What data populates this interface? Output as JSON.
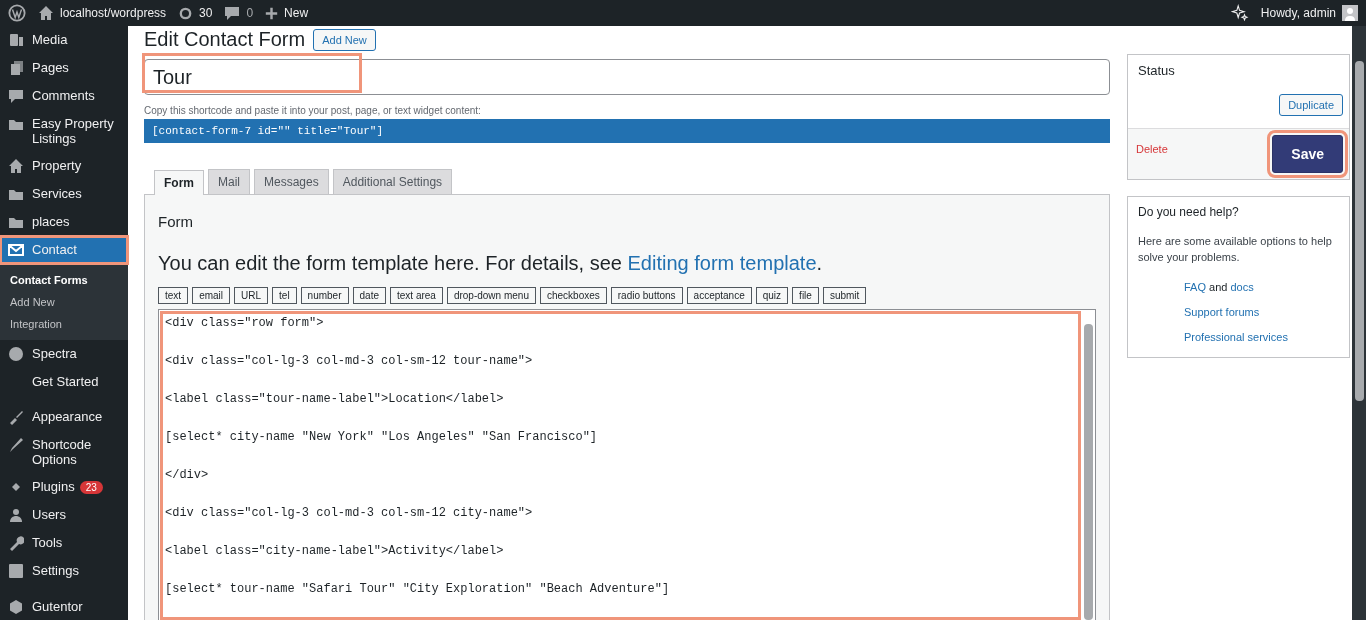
{
  "admin_bar": {
    "site": "localhost/wordpress",
    "updates": "30",
    "comments": "0",
    "new": "New",
    "greeting": "Howdy, admin"
  },
  "sidebar": {
    "items": [
      {
        "label": "Media",
        "selected": false,
        "highlighted": false
      },
      {
        "label": "Pages",
        "selected": false,
        "highlighted": false
      },
      {
        "label": "Comments",
        "selected": false,
        "highlighted": false
      },
      {
        "label": "Easy Property Listings",
        "selected": false,
        "highlighted": false
      },
      {
        "label": "Property",
        "selected": false,
        "highlighted": false
      },
      {
        "label": "Services",
        "selected": false,
        "highlighted": false
      },
      {
        "label": "places",
        "selected": false,
        "highlighted": false
      },
      {
        "label": "Contact",
        "selected": true,
        "highlighted": true,
        "children": [
          {
            "label": "Contact Forms",
            "selected": true
          },
          {
            "label": "Add New",
            "selected": false
          },
          {
            "label": "Integration",
            "selected": false
          }
        ]
      },
      {
        "label": "Spectra",
        "selected": false,
        "highlighted": false
      },
      {
        "label": "Get Started",
        "selected": false,
        "highlighted": false
      },
      {
        "label": "Appearance",
        "selected": false,
        "highlighted": false
      },
      {
        "label": "Shortcode Options",
        "selected": false,
        "highlighted": false
      },
      {
        "label": "Plugins",
        "selected": false,
        "highlighted": false,
        "badge": "23"
      },
      {
        "label": "Users",
        "selected": false,
        "highlighted": false
      },
      {
        "label": "Tools",
        "selected": false,
        "highlighted": false
      },
      {
        "label": "Settings",
        "selected": false,
        "highlighted": false
      },
      {
        "label": "Gutentor",
        "selected": false,
        "highlighted": false
      }
    ]
  },
  "page": {
    "title": "Edit Contact Form",
    "add_new": "Add New"
  },
  "title_field": {
    "value": "Tour",
    "highlighted": true
  },
  "shortcode": {
    "hint": "Copy this shortcode and paste it into your post, page, or text widget content:",
    "code": "[contact-form-7 id=\"\" title=\"Tour\"]"
  },
  "tabs": [
    {
      "label": "Form",
      "selected": true
    },
    {
      "label": "Mail",
      "selected": false
    },
    {
      "label": "Messages",
      "selected": false
    },
    {
      "label": "Additional Settings",
      "selected": false
    }
  ],
  "form_panel": {
    "heading": "Form",
    "intro": "You can edit the form template here. For details, see ",
    "link": "Editing form template",
    "after": ".",
    "tags": [
      "text",
      "email",
      "URL",
      "tel",
      "number",
      "date",
      "text area",
      "drop-down menu",
      "checkboxes",
      "radio buttons",
      "acceptance",
      "quiz",
      "file",
      "submit"
    ],
    "code_highlighted": true,
    "code": [
      "<div class=\"row form\">",
      "<div class=\"col-lg-3 col-md-3 col-sm-12 tour-name\">",
      "<label class=\"tour-name-label\">Location</label>",
      "[select* city-name \"New York\" \"Los Angeles\" \"San Francisco\"]",
      "</div>",
      "<div class=\"col-lg-3 col-md-3 col-sm-12 city-name\">",
      "<label class=\"city-name-label\">Activity</label>",
      "[select* tour-name \"Safari Tour\" \"City Exploration\" \"Beach Adventure\"]"
    ]
  },
  "status_box": {
    "title": "Status",
    "duplicate": "Duplicate",
    "delete": "Delete",
    "save": "Save",
    "save_highlighted": true
  },
  "help_box": {
    "title": "Do you need help?",
    "text": "Here are some available options to help solve your problems.",
    "faq": "FAQ",
    "and": "and",
    "docs": "docs",
    "forums": "Support forums",
    "services": "Professional services"
  }
}
